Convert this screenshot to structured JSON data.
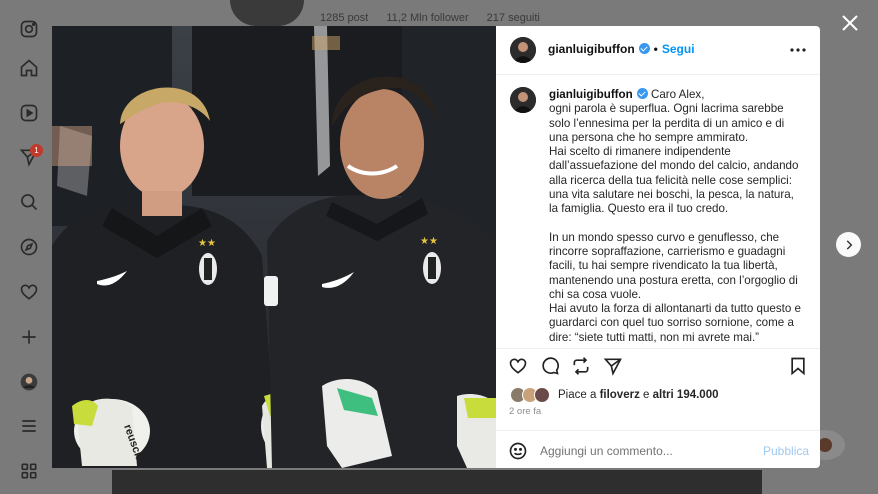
{
  "background": {
    "profile_stats": [
      "1285 post",
      "11,2 Mln follower",
      "217 seguiti"
    ]
  },
  "nav": {
    "items": [
      {
        "icon": "instagram-icon"
      },
      {
        "icon": "home-icon"
      },
      {
        "icon": "reels-icon"
      },
      {
        "icon": "messages-icon",
        "badge": "1"
      },
      {
        "icon": "search-icon"
      },
      {
        "icon": "explore-icon"
      },
      {
        "icon": "heart-icon"
      },
      {
        "icon": "create-icon"
      },
      {
        "icon": "profile-icon"
      },
      {
        "icon": "menu-icon"
      },
      {
        "icon": "apps-icon"
      }
    ]
  },
  "post": {
    "username": "gianluigibuffon",
    "verified": true,
    "separator": "•",
    "follow_label": "Segui",
    "caption_greeting": "Caro Alex,",
    "caption_paragraphs": [
      "ogni parola è superflua. Ogni lacrima sarebbe solo l’ennesima per la perdita di un amico e di una persona che ho sempre ammirato.",
      "Hai scelto di rimanere indipendente dall’assuefazione del mondo del calcio, andando alla ricerca della tua felicità nelle cose semplici: una vita salutare nei boschi, la pesca, la natura, la famiglia. Questo era il tuo credo.",
      "",
      "In un mondo spesso curvo e genuflesso, che rincorre sopraffazione, carrierismo e guadagni facili, tu hai sempre rivendicato la tua libertà, mantenendo una postura eretta, con l’orgoglio di chi sa cosa vuole.",
      "Hai avuto la forza di allontanarti da tutto questo e guardarci con quel tuo sorriso sornione, come a dire: “siete tutti matti, non mi avrete mai.”"
    ],
    "likes_prefix": "Piace a",
    "likes_user": "filoverz",
    "likes_and": "e",
    "likes_count": "altri 194.000",
    "time": "2 ore fa",
    "comment_placeholder": "Aggiungi un commento...",
    "publish_label": "Pubblica"
  },
  "colors": {
    "accent": "#0095f6",
    "publish_disabled": "#a0c9f0",
    "overlay": "#6f6f6f"
  }
}
